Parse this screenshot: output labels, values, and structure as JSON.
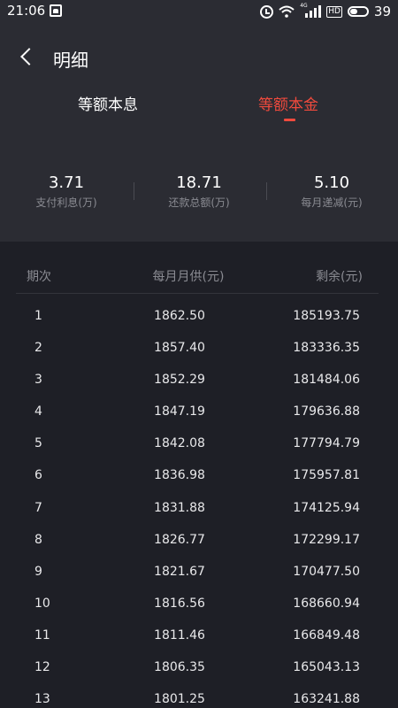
{
  "status": {
    "time": "21:06",
    "battery": "39",
    "network_tag": "4G",
    "hd_label": "HD"
  },
  "header": {
    "title": "明细"
  },
  "tabs": [
    {
      "label": "等额本息",
      "active": false
    },
    {
      "label": "等额本金",
      "active": true
    }
  ],
  "summary": [
    {
      "value": "3.71",
      "label": "支付利息(万)"
    },
    {
      "value": "18.71",
      "label": "还款总额(万)"
    },
    {
      "value": "5.10",
      "label": "每月递减(元)"
    }
  ],
  "table": {
    "headers": [
      "期次",
      "每月月供(元)",
      "剩余(元)"
    ],
    "rows": [
      [
        "1",
        "1862.50",
        "185193.75"
      ],
      [
        "2",
        "1857.40",
        "183336.35"
      ],
      [
        "3",
        "1852.29",
        "181484.06"
      ],
      [
        "4",
        "1847.19",
        "179636.88"
      ],
      [
        "5",
        "1842.08",
        "177794.79"
      ],
      [
        "6",
        "1836.98",
        "175957.81"
      ],
      [
        "7",
        "1831.88",
        "174125.94"
      ],
      [
        "8",
        "1826.77",
        "172299.17"
      ],
      [
        "9",
        "1821.67",
        "170477.50"
      ],
      [
        "10",
        "1816.56",
        "168660.94"
      ],
      [
        "11",
        "1811.46",
        "166849.48"
      ],
      [
        "12",
        "1806.35",
        "165043.13"
      ],
      [
        "13",
        "1801.25",
        "163241.88"
      ]
    ]
  },
  "colors": {
    "accent": "#f04a3d",
    "top_bg": "#2b2c33",
    "page_bg": "#1e1f26",
    "muted": "#8a8b92"
  }
}
